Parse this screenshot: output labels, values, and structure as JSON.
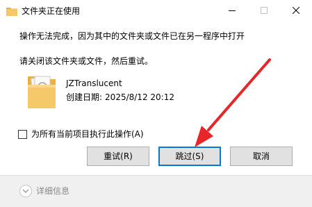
{
  "window": {
    "title": "文件夹正在使用",
    "minimize_icon": "minimize-icon",
    "maximize_icon": "maximize-icon",
    "close_icon": "close-icon"
  },
  "message": {
    "line1": "操作无法完成，因为其中的文件夹或文件已在另一程序中打开",
    "line2": "请关闭该文件夹或文件，然后重试。"
  },
  "file": {
    "icon": "folder-icon",
    "name": "JZTranslucent",
    "date_label": "创建日期:",
    "date_value": "2025/8/12 20:12"
  },
  "checkbox": {
    "label": "为所有当前项目执行此操作(A)",
    "checked": false
  },
  "buttons": {
    "retry": "重试(R)",
    "skip": "跳过(S)",
    "cancel": "取消"
  },
  "footer": {
    "details": "详细信息"
  },
  "colors": {
    "accent": "#0078d7",
    "annotation_arrow": "#e8262a",
    "folder": "#f5c86a"
  }
}
